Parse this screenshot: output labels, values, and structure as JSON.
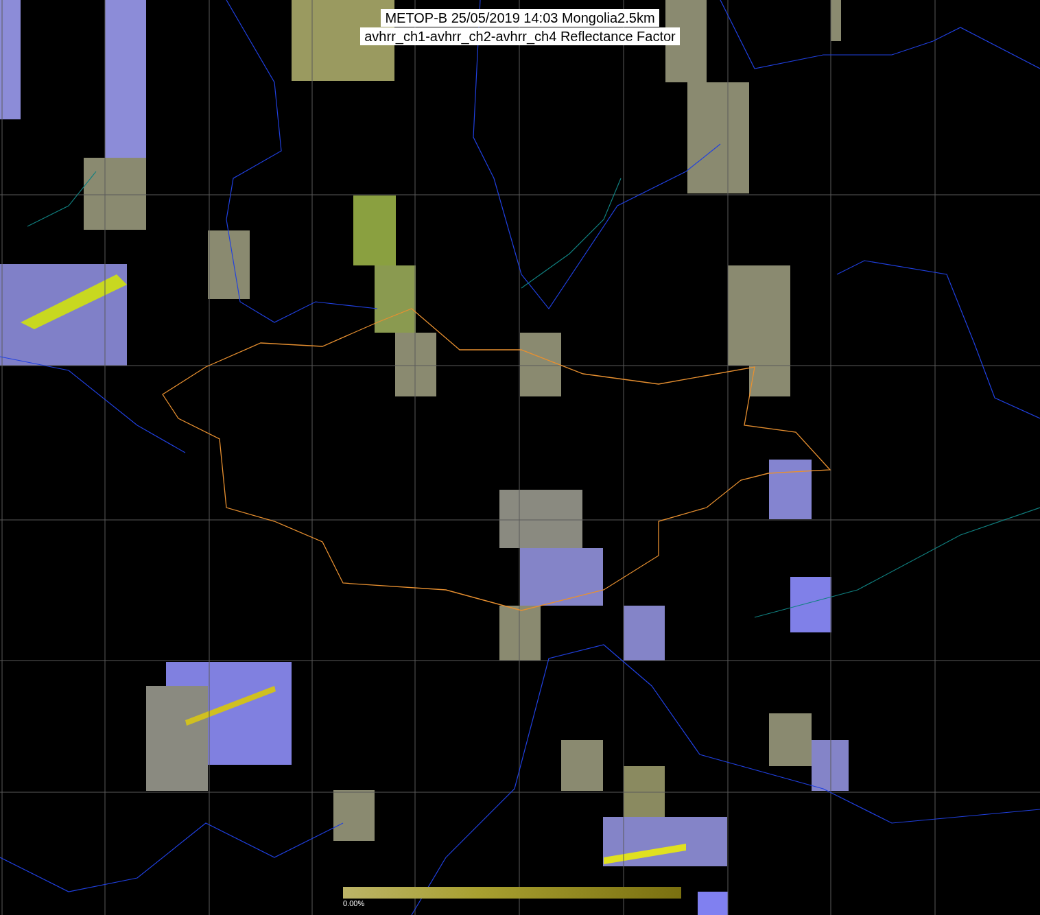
{
  "title": {
    "lines": [
      "METOP-B 25/05/2019 14:03 Mongolia2.5km",
      "avhrr_ch1-avhrr_ch2-avhrr_ch4 Reflectance Factor"
    ]
  },
  "colorbar": {
    "label": "0.00%"
  }
}
